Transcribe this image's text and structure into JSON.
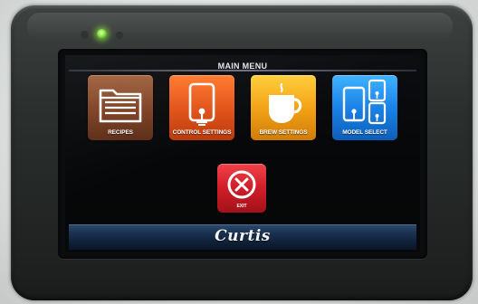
{
  "device": {
    "indicator_led_color": "#8fe34a",
    "bezel_color": "#2b2f2e"
  },
  "screen": {
    "title": "MAIN MENU",
    "tiles": [
      {
        "label": "RECIPES",
        "icon": "folder-icon",
        "color": "#7d4024"
      },
      {
        "label": "CONTROL SETTINGS",
        "icon": "control-panel-icon",
        "color": "#e4541a"
      },
      {
        "label": "BREW SETTINGS",
        "icon": "coffee-cup-icon",
        "color": "#f4a316"
      },
      {
        "label": "MODEL SELECT",
        "icon": "model-select-icon",
        "color": "#1a82e6"
      }
    ],
    "exit": {
      "label": "EXIT",
      "icon": "close-circle-icon",
      "color": "#d01e28"
    },
    "footer": {
      "logo_text": "Curtis",
      "color": "#1b3150"
    }
  }
}
